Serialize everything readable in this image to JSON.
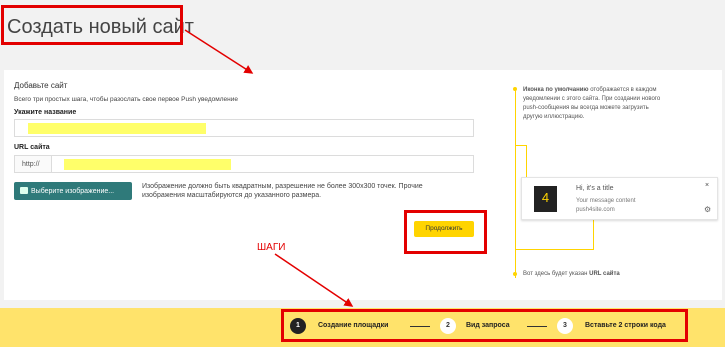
{
  "page": {
    "title": "Создать новый сайт"
  },
  "form": {
    "section_title": "Добавьте сайт",
    "intro": "Всего три простых шага, чтобы разослать свое первое Push уведомление",
    "name_label": "Укажите название",
    "url_label": "URL сайта",
    "url_prefix": "http://",
    "image_button_label": "Выберите изображение...",
    "image_note": "Изображение должно быть квадратным, разрешение не более 300х300 точек. Прочие изображения масштабируются до указанного размера.",
    "continue_label": "Продолжить"
  },
  "preview": {
    "hint_top_bold": "Иконка по умолчанию",
    "hint_top_rest": " отображается в каждом уведомлении с этого сайта. При создании нового push-сообщения вы всегда можете загрузить другую иллюстрацию.",
    "hint_bottom_prefix": "Вот здесь будет указан ",
    "hint_bottom_bold": "URL сайта",
    "notification": {
      "icon_text": "4",
      "title": "Hi, it's a title",
      "message": "Your message content",
      "url": "push4site.com",
      "close": "×",
      "gear": "⚙"
    }
  },
  "annotation": {
    "steps_label": "ШАГИ"
  },
  "steps": [
    {
      "number": "1",
      "label": "Создание площадки",
      "active": true
    },
    {
      "number": "2",
      "label": "Вид запроса",
      "active": false
    },
    {
      "number": "3",
      "label": "Вставьте 2 строки кода",
      "active": false
    }
  ],
  "colors": {
    "accent": "#ffd400",
    "annotation_red": "#e30000",
    "image_button": "#2f7a7a",
    "footer": "#ffe36b"
  }
}
